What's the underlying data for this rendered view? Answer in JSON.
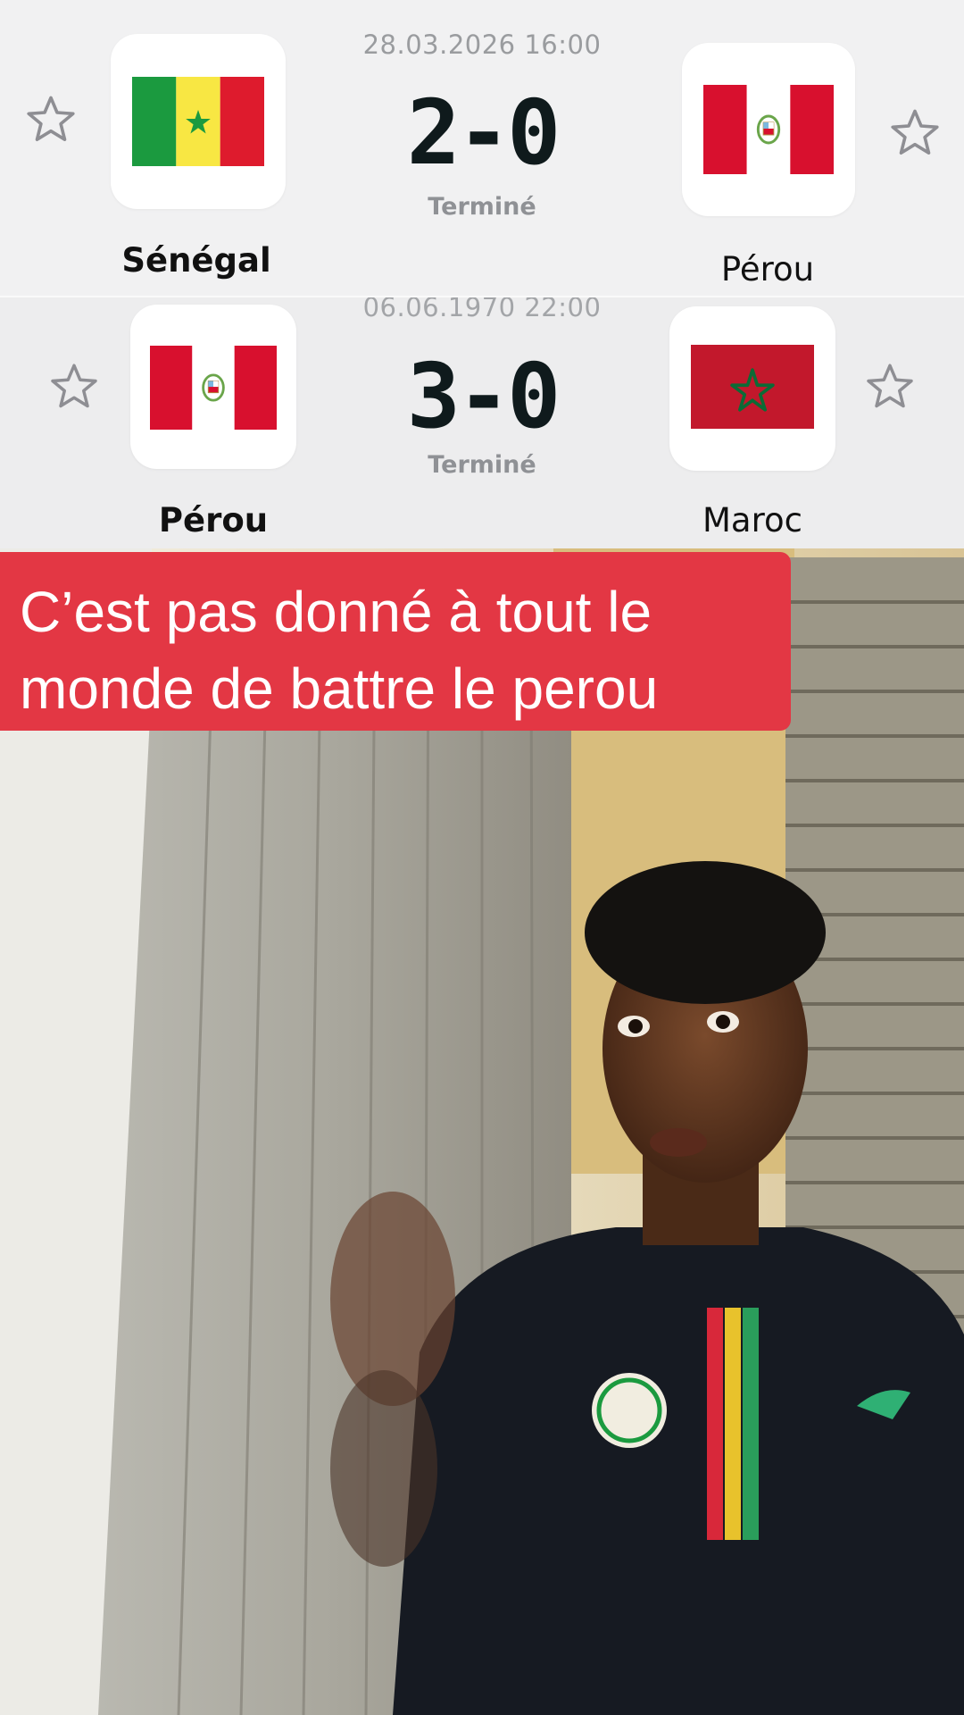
{
  "matches": [
    {
      "datetime": "28.03.2026 16:00",
      "score": "2-0",
      "status": "Terminé",
      "home": {
        "name": "Sénégal",
        "flag": "senegal-flag"
      },
      "away": {
        "name": "Pérou",
        "flag": "peru-flag"
      }
    },
    {
      "datetime": "06.06.1970 22:00",
      "score": "3-0",
      "status": "Terminé",
      "home": {
        "name": "Pérou",
        "flag": "peru-flag"
      },
      "away": {
        "name": "Maroc",
        "flag": "morocco-flag"
      }
    }
  ],
  "caption": {
    "line1": "C’est pas donné à tout le",
    "line2": "monde de battre le perou"
  },
  "colors": {
    "caption_bg": "#e33744",
    "score_text": "#0f1a1c",
    "senegal_green": "#1b9a3f",
    "senegal_yellow": "#f8e743",
    "senegal_red": "#de1b2d",
    "peru_red": "#d8102e",
    "morocco_red": "#c2182c",
    "morocco_star": "#0c6b36"
  }
}
